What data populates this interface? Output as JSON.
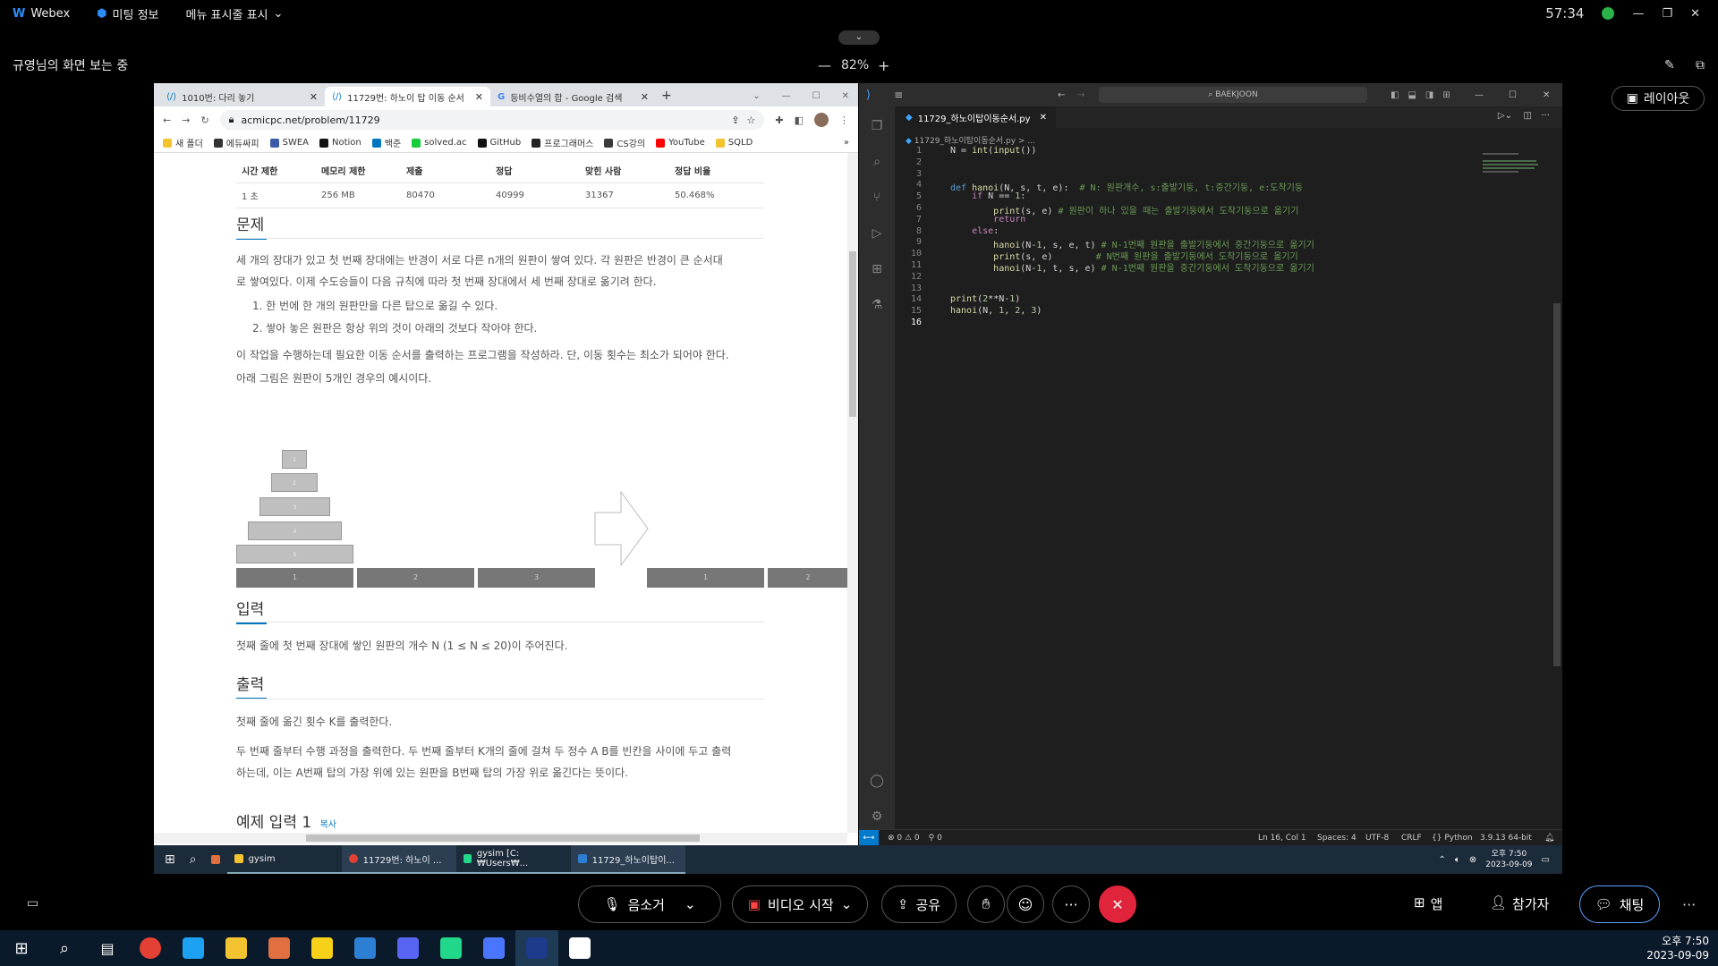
{
  "webex": {
    "app_name": "Webex",
    "meeting_info": "미팅 정보",
    "view_menu": "메뉴 표시줄 표시",
    "time": "57:34",
    "viewing": "규영님의 화면 보는 중",
    "zoom": "82%",
    "zoom_minus": "—",
    "zoom_plus": "+",
    "layout": "레이아웃",
    "controls": {
      "mute": "음소거",
      "video": "비디오 시작",
      "share": "공유",
      "more": "···",
      "apps": "앱",
      "participants": "참가자",
      "chat": "채팅"
    }
  },
  "browser": {
    "tabs": [
      {
        "label": "1010번: 다리 놓기"
      },
      {
        "label": "11729번: 하노이 탑 이동 순서"
      },
      {
        "label": "등비수열의 합 - Google 검색"
      }
    ],
    "url": "acmicpc.net/problem/11729",
    "bookmarks": [
      "새 폴더",
      "에듀싸피",
      "SWEA",
      "Notion",
      "백준",
      "solved.ac",
      "GitHub",
      "프로그래머스",
      "CS강의",
      "YouTube",
      "SQLD"
    ],
    "bookmark_colors": [
      "#f4c430",
      "#333333",
      "#3b5ba9",
      "#111111",
      "#0076c0",
      "#17ce3a",
      "#111111",
      "#222222",
      "#3a3a3a",
      "#ff0000",
      "#f4c430"
    ],
    "stats_headers": [
      "시간 제한",
      "메모리 제한",
      "제출",
      "정답",
      "맞힌 사람",
      "정답 비율"
    ],
    "stats_values": [
      "1 초",
      "256 MB",
      "80470",
      "40999",
      "31367",
      "50.468%"
    ],
    "section_problem": "문제",
    "problem_p1a": "세 개의 장대가 있고 첫 번째 장대에는 반경이 서로 다른 n개의 원판이 쌓여 있다. 각 원판은 반경이 큰 순서대",
    "problem_p1b": "로 쌓여있다. 이제 수도승들이 다음 규칙에 따라 첫 번째 장대에서 세 번째 장대로 옮기려 한다.",
    "rule1": "1. 한 번에 한 개의 원판만을 다른 탑으로 옮길 수 있다.",
    "rule2": "2. 쌓아 놓은 원판은 항상 위의 것이 아래의 것보다 작아야 한다.",
    "problem_p2": "이 작업을 수행하는데 필요한 이동 순서를 출력하는 프로그램을 작성하라. 단, 이동 횟수는 최소가 되어야 한다.",
    "problem_p3": "아래 그림은 원판이 5개인 경우의 예시이다.",
    "disk_labels": [
      "1",
      "2",
      "3",
      "4",
      "5"
    ],
    "peg_labels": [
      "1",
      "2",
      "3",
      "1",
      "2"
    ],
    "section_input": "입력",
    "input_text": "첫째 줄에 첫 번째 장대에 쌓인 원판의 개수 N (1 ≤ N ≤ 20)이 주어진다.",
    "section_output": "출력",
    "output_p1": "첫째 줄에 옮긴 횟수 K를 출력한다.",
    "output_p2a": "두 번째 줄부터 수행 과정을 출력한다. 두 번째 줄부터 K개의 줄에 걸쳐 두 정수 A B를 빈칸을 사이에 두고 출력",
    "output_p2b": "하는데, 이는 A번째 탑의 가장 위에 있는 원판을 B번째 탑의 가장 위로 옮긴다는 뜻이다.",
    "section_example": "예제 입력 1",
    "copy_label": "복사"
  },
  "vscode": {
    "search": "BAEKJOON",
    "tab_file": "11729_하노이탑이동순서.py",
    "breadcrumb": "11729_하노이탑이동순서.py > ...",
    "lines": [
      "N = int(input())",
      "",
      "",
      "def hanoi(N, s, t, e):  # N: 원판개수, s:출발기둥, t:중간기둥, e:도착기둥",
      "    if N == 1:",
      "        print(s, e) # 원판이 하나 있을 때는 출발기둥에서 도착기둥으로 옮기기",
      "        return",
      "    else:",
      "        hanoi(N-1, s, e, t) # N-1번째 원판을 출발기둥에서 중간기둥으로 옮기기",
      "        print(s, e)        # N번째 원판을 출발기둥에서 도착기둥으로 옮기기",
      "        hanoi(N-1, t, s, e) # N-1번째 원판을 중간기둥에서 도착기둥으로 옮기기",
      "",
      "",
      "print(2**N-1)",
      "hanoi(N, 1, 2, 3)",
      ""
    ],
    "status": {
      "errors": "⊗ 0 ⚠ 0",
      "ports": "⚲ 0",
      "position": "Ln 16, Col 1",
      "spaces": "Spaces: 4",
      "encoding": "UTF-8",
      "eol": "CRLF",
      "language": "Python",
      "interpreter": "3.9.13 64-bit"
    }
  },
  "inner_taskbar": {
    "items": [
      "gysim",
      "11729번: 하노이 ...",
      "gysim [C:₩Users₩...",
      "11729_하노이탑이..."
    ],
    "time": "오후 7:50",
    "date": "2023-09-09"
  },
  "windows_taskbar": {
    "time": "오후 7:50",
    "date": "2023-09-09",
    "app_colors": [
      "#e34133",
      "#1da1f2",
      "#f4c430",
      "#e07040",
      "#f7d117",
      "#2d7fd3",
      "#5865f2",
      "#21d789",
      "#4a76ff",
      "#1e3a8a",
      "#ffffff"
    ]
  }
}
